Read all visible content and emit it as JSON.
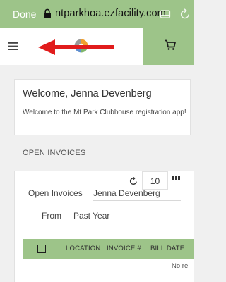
{
  "browser": {
    "done_label": "Done",
    "url": "ntparkhoa.ezfacility.com"
  },
  "colors": {
    "accent": "#9dc489",
    "annotation_arrow": "#e11c1c"
  },
  "header": {
    "menu_icon": "hamburger-icon",
    "logo_icon": "logo-icon",
    "cart_icon": "cart-icon"
  },
  "welcome": {
    "title": "Welcome, Jenna Devenberg",
    "text": "Welcome to the Mt Park Clubhouse registration app!"
  },
  "invoices": {
    "section_title": "OPEN INVOICES",
    "toolbar": {
      "refresh_icon": "refresh-icon",
      "page_size": "10",
      "grid_icon": "grid-icon"
    },
    "filters": {
      "open_invoices_label": "Open Invoices",
      "open_invoices_value": "Jenna Devenberg",
      "from_label": "From",
      "from_value": "Past Year"
    },
    "columns": [
      "LOCATION",
      "INVOICE #",
      "BILL DATE"
    ],
    "no_records_text": "No re"
  }
}
